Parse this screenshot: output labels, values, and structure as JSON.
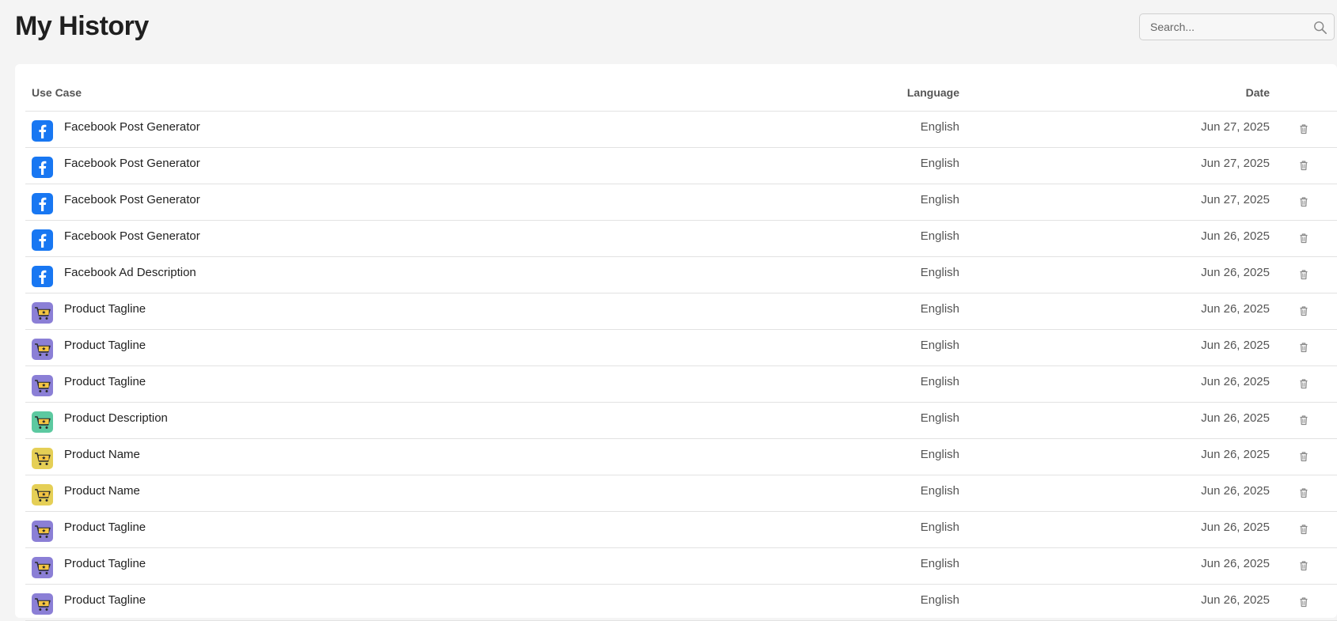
{
  "page": {
    "title": "My History"
  },
  "search": {
    "placeholder": "Search...",
    "value": ""
  },
  "table": {
    "headers": {
      "use_case": "Use Case",
      "language": "Language",
      "date": "Date"
    },
    "rows": [
      {
        "icon": "facebook-icon",
        "use_case": "Facebook Post Generator",
        "language": "English",
        "date": "Jun 27, 2025"
      },
      {
        "icon": "facebook-icon",
        "use_case": "Facebook Post Generator",
        "language": "English",
        "date": "Jun 27, 2025"
      },
      {
        "icon": "facebook-icon",
        "use_case": "Facebook Post Generator",
        "language": "English",
        "date": "Jun 27, 2025"
      },
      {
        "icon": "facebook-icon",
        "use_case": "Facebook Post Generator",
        "language": "English",
        "date": "Jun 26, 2025"
      },
      {
        "icon": "facebook-icon",
        "use_case": "Facebook Ad Description",
        "language": "English",
        "date": "Jun 26, 2025"
      },
      {
        "icon": "cart-purple-icon",
        "use_case": "Product Tagline",
        "language": "English",
        "date": "Jun 26, 2025"
      },
      {
        "icon": "cart-purple-icon",
        "use_case": "Product Tagline",
        "language": "English",
        "date": "Jun 26, 2025"
      },
      {
        "icon": "cart-purple-icon",
        "use_case": "Product Tagline",
        "language": "English",
        "date": "Jun 26, 2025"
      },
      {
        "icon": "cart-green-icon",
        "use_case": "Product Description",
        "language": "English",
        "date": "Jun 26, 2025"
      },
      {
        "icon": "cart-yellow-icon",
        "use_case": "Product Name",
        "language": "English",
        "date": "Jun 26, 2025"
      },
      {
        "icon": "cart-yellow-icon",
        "use_case": "Product Name",
        "language": "English",
        "date": "Jun 26, 2025"
      },
      {
        "icon": "cart-purple-icon",
        "use_case": "Product Tagline",
        "language": "English",
        "date": "Jun 26, 2025"
      },
      {
        "icon": "cart-purple-icon",
        "use_case": "Product Tagline",
        "language": "English",
        "date": "Jun 26, 2025"
      },
      {
        "icon": "cart-purple-icon",
        "use_case": "Product Tagline",
        "language": "English",
        "date": "Jun 26, 2025"
      }
    ]
  },
  "colors": {
    "facebook": "#1877f2",
    "cart_purple": "#8b7fd6",
    "cart_green": "#5cc9a0",
    "cart_yellow": "#e5cf56",
    "cart_body": "#f5c542"
  }
}
